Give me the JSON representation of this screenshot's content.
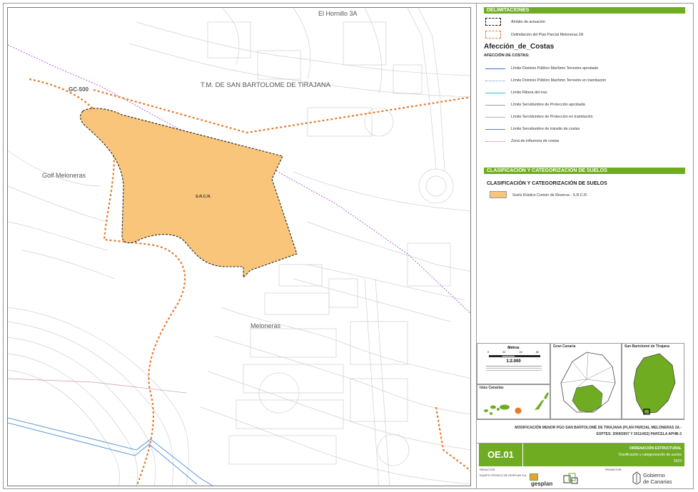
{
  "map": {
    "labels": {
      "hornillo": "El Hornillo 3A",
      "municipality": "T.M. DE SAN BARTOLOME DE TIRAJANA",
      "road": "GC-500",
      "golf": "Golf Meloneras",
      "meloneras": "Meloneras",
      "srcr": "S.R.C.R."
    },
    "colors": {
      "parcel_fill": "#f9c57a",
      "plan_boundary": "#e87a2c",
      "coast_influence": "#b060d8",
      "water_line": "#4a8fd6",
      "background_lines": "#bdbdbd"
    }
  },
  "legend": {
    "delimitaciones_title": "DELIMITACIONES",
    "ambito": "Ámbito de actuación",
    "plan_parcial": "Delimitación del Plan Parcial Meloneras 2A",
    "afeccion_title": "Afección_de_Costas",
    "afeccion_sub": "AFECCIÓN DE COSTAS:",
    "coast_items": [
      {
        "label": "Límite Dominio Público Marítimo Terrestre aprobado",
        "color": "#3a6fd0",
        "style": "solid"
      },
      {
        "label": "Límite Dominio Público Marítimo Terrestre en tramitación",
        "color": "#6a8fe0",
        "style": "dotted"
      },
      {
        "label": "Límite Ribera del mar",
        "color": "#35c4c0",
        "style": "solid"
      },
      {
        "label": "Límite Servidumbre de Protección aprobada",
        "color": "#9a9a9a",
        "style": "solid"
      },
      {
        "label": "Límite Servidumbre de Protección en tramitación",
        "color": "#b0b0b0",
        "style": "solid"
      },
      {
        "label": "Límite Servidumbre de tránsito de costas",
        "color": "#5a7ad0",
        "style": "solid"
      },
      {
        "label": "Zona de influencia de costas",
        "color": "#c060e0",
        "style": "dotted"
      }
    ],
    "clasificacion_bar": "CLASIFICACIÓN Y CATEGORIZACIÓN DE SUELOS",
    "clasificacion_title": "CLASIFICACIÓN Y CATEGORIZACIÓN DE SUELOS",
    "suelo_item": "Suelo Rústico Común de Reserva - S.R.C.R."
  },
  "insets": {
    "scale_title": "Metros",
    "scale_ticks": [
      "0",
      "20",
      "40",
      "80"
    ],
    "scale_ratio": "1:2.000",
    "gran_canaria": "Gran Canaria",
    "san_bartolome": "San Bartolomé de Tirajana",
    "islas_canarias": "Islas Canarias"
  },
  "title_block": {
    "line1": "MODIFICACIÓN MENOR PGO SAN BARTOLOMÉ DE TIRAJANA (PLAN PARCIAL MELONERAS 2A -",
    "line2": "EXPTES: 2009/2007 Y 2011/452) PARCELA APHB-3",
    "plan_code": "OE.01",
    "ordenacion": "ORDENACIÓN ESTRUCTURAL",
    "subtitle": "Clasificación y categorización de suelos",
    "year": "2023",
    "redactor_label": "REDACTOR:",
    "redactor": "EQUIPO TÉCNICO DE GESPLAN S.A.",
    "promotor_label": "PROMOTOR:",
    "gesplan": "gesplan",
    "gobierno_1": "Gobierno",
    "gobierno_2": "de Canarias"
  }
}
